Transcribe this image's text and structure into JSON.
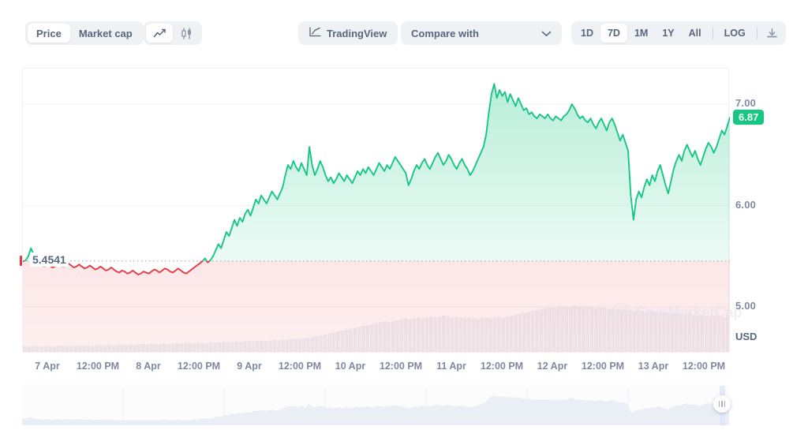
{
  "toolbar": {
    "price_label": "Price",
    "marketcap_label": "Market cap",
    "line_icon": "line-chart-icon",
    "candle_icon": "candlestick-chart-icon",
    "tradingview_label": "TradingView",
    "tradingview_icon": "tradingview-icon",
    "compare_label": "Compare with",
    "chevron_icon": "chevron-down-icon",
    "download_icon": "download-icon",
    "ranges": [
      "1D",
      "7D",
      "1M",
      "1Y",
      "All"
    ],
    "active_range": "7D",
    "log_label": "LOG"
  },
  "chart_data": {
    "type": "line",
    "title": "",
    "xlabel": "",
    "ylabel": "USD",
    "currency": "USD",
    "ylim": [
      4.55,
      7.35
    ],
    "yticks": [
      "7.00",
      "6.00",
      "5.00"
    ],
    "ytick_values": [
      7.0,
      6.0,
      5.0
    ],
    "grid": true,
    "legend": false,
    "current_price": "6.87",
    "current_price_value": 6.87,
    "open_price": "5.4541",
    "open_price_value": 5.4541,
    "baseline_value": 5.4541,
    "up_color": "#16c784",
    "down_color": "#ea3943",
    "xticks": [
      "7 Apr",
      "12:00 PM",
      "8 Apr",
      "12:00 PM",
      "9 Apr",
      "12:00 PM",
      "10 Apr",
      "12:00 PM",
      "11 Apr",
      "12:00 PM",
      "12 Apr",
      "12:00 PM",
      "13 Apr",
      "12:00 PM"
    ],
    "x": [
      0,
      1,
      2,
      3,
      4,
      5,
      6,
      7,
      8,
      9,
      10,
      11,
      12,
      13,
      14,
      15,
      16,
      17,
      18,
      19,
      20,
      21,
      22,
      23,
      24,
      25,
      26,
      27,
      28,
      29,
      30,
      31,
      32,
      33,
      34,
      35,
      36,
      37,
      38,
      39,
      40,
      41,
      42,
      43,
      44,
      45,
      46,
      47,
      48,
      49,
      50,
      51,
      52,
      53,
      54,
      55,
      56,
      57,
      58,
      59,
      60,
      61,
      62,
      63,
      64,
      65,
      66,
      67,
      68,
      69,
      70,
      71,
      72,
      73,
      74,
      75,
      76,
      77,
      78,
      79,
      80,
      81,
      82,
      83,
      84,
      85,
      86,
      87,
      88,
      89,
      90,
      91,
      92,
      93,
      94,
      95,
      96,
      97,
      98,
      99,
      100,
      101,
      102,
      103,
      104,
      105,
      106,
      107,
      108,
      109,
      110,
      111,
      112,
      113,
      114,
      115,
      116,
      117,
      118,
      119,
      120,
      121,
      122,
      123,
      124,
      125,
      126,
      127,
      128,
      129,
      130,
      131,
      132,
      133,
      134,
      135,
      136,
      137,
      138,
      139,
      140,
      141,
      142,
      143,
      144,
      145,
      146,
      147,
      148,
      149,
      150,
      151,
      152,
      153,
      154,
      155,
      156,
      157,
      158,
      159,
      160,
      161,
      162,
      163,
      164,
      165,
      166,
      167,
      168
    ],
    "values": [
      5.45,
      5.46,
      5.5,
      5.58,
      5.52,
      5.46,
      5.43,
      5.41,
      5.4,
      5.42,
      5.41,
      5.39,
      5.4,
      5.43,
      5.42,
      5.4,
      5.41,
      5.43,
      5.41,
      5.39,
      5.4,
      5.42,
      5.4,
      5.38,
      5.39,
      5.41,
      5.39,
      5.37,
      5.38,
      5.4,
      5.38,
      5.36,
      5.37,
      5.39,
      5.37,
      5.35,
      5.34,
      5.36,
      5.35,
      5.33,
      5.34,
      5.36,
      5.34,
      5.32,
      5.33,
      5.35,
      5.34,
      5.33,
      5.35,
      5.37,
      5.36,
      5.34,
      5.36,
      5.38,
      5.37,
      5.35,
      5.34,
      5.36,
      5.38,
      5.36,
      5.34,
      5.33,
      5.35,
      5.37,
      5.39,
      5.41,
      5.43,
      5.45,
      5.48,
      5.44,
      5.46,
      5.5,
      5.56,
      5.62,
      5.58,
      5.66,
      5.74,
      5.7,
      5.78,
      5.86,
      5.8,
      5.88,
      5.84,
      5.92,
      5.96,
      5.9,
      5.98,
      6.06,
      6.02,
      6.1,
      6.06,
      6.02,
      6.08,
      6.14,
      6.1,
      6.06,
      6.12,
      6.18,
      6.3,
      6.4,
      6.36,
      6.44,
      6.38,
      6.34,
      6.42,
      6.36,
      6.3,
      6.58,
      6.4,
      6.3,
      6.36,
      6.44,
      6.38,
      6.3,
      6.24,
      6.28,
      6.22,
      6.26,
      6.32,
      6.28,
      6.24,
      6.3,
      6.26,
      6.22,
      6.28,
      6.34,
      6.3,
      6.36,
      6.32,
      6.38,
      6.34,
      6.3,
      6.36,
      6.42,
      6.38,
      6.34,
      6.4,
      6.36,
      6.42,
      6.48,
      6.44,
      6.4,
      6.36,
      6.32,
      6.2,
      6.26,
      6.34,
      6.4,
      6.36,
      6.42,
      6.46,
      6.4,
      6.36,
      6.42,
      6.48,
      6.52,
      6.46,
      6.4,
      6.44,
      6.5,
      6.46,
      6.4,
      6.36,
      6.42,
      6.46,
      6.4,
      6.36,
      6.3,
      6.34,
      6.4,
      6.46,
      6.52,
      6.58,
      6.7,
      6.92,
      7.1,
      7.2,
      7.06,
      7.14,
      7.08,
      7.12,
      7.02,
      7.1,
      7.04,
      6.98,
      7.06,
      7.0,
      6.94,
      6.96,
      6.9,
      6.92,
      6.88,
      6.86,
      6.9,
      6.88,
      6.86,
      6.9,
      6.86,
      6.84,
      6.88,
      6.86,
      6.84,
      6.88,
      6.9,
      6.94,
      7.0,
      6.96,
      6.9,
      6.86,
      6.88,
      6.84,
      6.82,
      6.86,
      6.8,
      6.76,
      6.82,
      6.86,
      6.8,
      6.74,
      6.82,
      6.86,
      6.8,
      6.72,
      6.64,
      6.7,
      6.62,
      6.54,
      6.1,
      5.86,
      6.06,
      6.14,
      6.08,
      6.18,
      6.26,
      6.2,
      6.3,
      6.24,
      6.34,
      6.4,
      6.3,
      6.2,
      6.12,
      6.24,
      6.36,
      6.44,
      6.5,
      6.44,
      6.54,
      6.6,
      6.54,
      6.48,
      6.54,
      6.46,
      6.4,
      6.48,
      6.56,
      6.62,
      6.58,
      6.52,
      6.58,
      6.66,
      6.74,
      6.7,
      6.78,
      6.87
    ],
    "volume": [
      0.1,
      0.1,
      0.11,
      0.1,
      0.1,
      0.11,
      0.1,
      0.1,
      0.11,
      0.12,
      0.11,
      0.1,
      0.11,
      0.12,
      0.11,
      0.12,
      0.11,
      0.12,
      0.13,
      0.12,
      0.13,
      0.12,
      0.13,
      0.14,
      0.13,
      0.14,
      0.13,
      0.14,
      0.15,
      0.14,
      0.15,
      0.16,
      0.15,
      0.16,
      0.15,
      0.16,
      0.17,
      0.16,
      0.17,
      0.18,
      0.17,
      0.18,
      0.17,
      0.18,
      0.19,
      0.18,
      0.19,
      0.2,
      0.19,
      0.2,
      0.21,
      0.2,
      0.21,
      0.22,
      0.21,
      0.22,
      0.23,
      0.22,
      0.23,
      0.24,
      0.23,
      0.24,
      0.25,
      0.26,
      0.25,
      0.26,
      0.27,
      0.28,
      0.3,
      0.32,
      0.34,
      0.36,
      0.38,
      0.4,
      0.42,
      0.44,
      0.46,
      0.48,
      0.5,
      0.52,
      0.54,
      0.56,
      0.58,
      0.6,
      0.62,
      0.64,
      0.62,
      0.64,
      0.66,
      0.68,
      0.7,
      0.68,
      0.7,
      0.72,
      0.7,
      0.72,
      0.74,
      0.72,
      0.74,
      0.76,
      0.74,
      0.72,
      0.74,
      0.72,
      0.7,
      0.72,
      0.7,
      0.68,
      0.7,
      0.72,
      0.7,
      0.72,
      0.74,
      0.72,
      0.74,
      0.76,
      0.78,
      0.8,
      0.82,
      0.84,
      0.86,
      0.88,
      0.9,
      0.92,
      0.94,
      0.92,
      0.94,
      0.96,
      0.94,
      0.96,
      0.98,
      0.96,
      0.94,
      0.96,
      0.94,
      0.92,
      0.94,
      0.92,
      0.9,
      0.92,
      0.9,
      0.88,
      0.9,
      0.88,
      0.86,
      0.88,
      0.86,
      0.84,
      0.86,
      0.84,
      0.82,
      0.84,
      0.82,
      0.8,
      0.82,
      0.8,
      0.78,
      0.8,
      0.78,
      0.76,
      0.78,
      0.76,
      0.74,
      0.76,
      0.74,
      0.72,
      0.74
    ]
  },
  "watermark": {
    "text": "CoinMarketCap",
    "logo_icon": "coinmarketcap-logo-icon"
  },
  "navigator": {
    "handle_icon": "drag-handle-icon"
  }
}
